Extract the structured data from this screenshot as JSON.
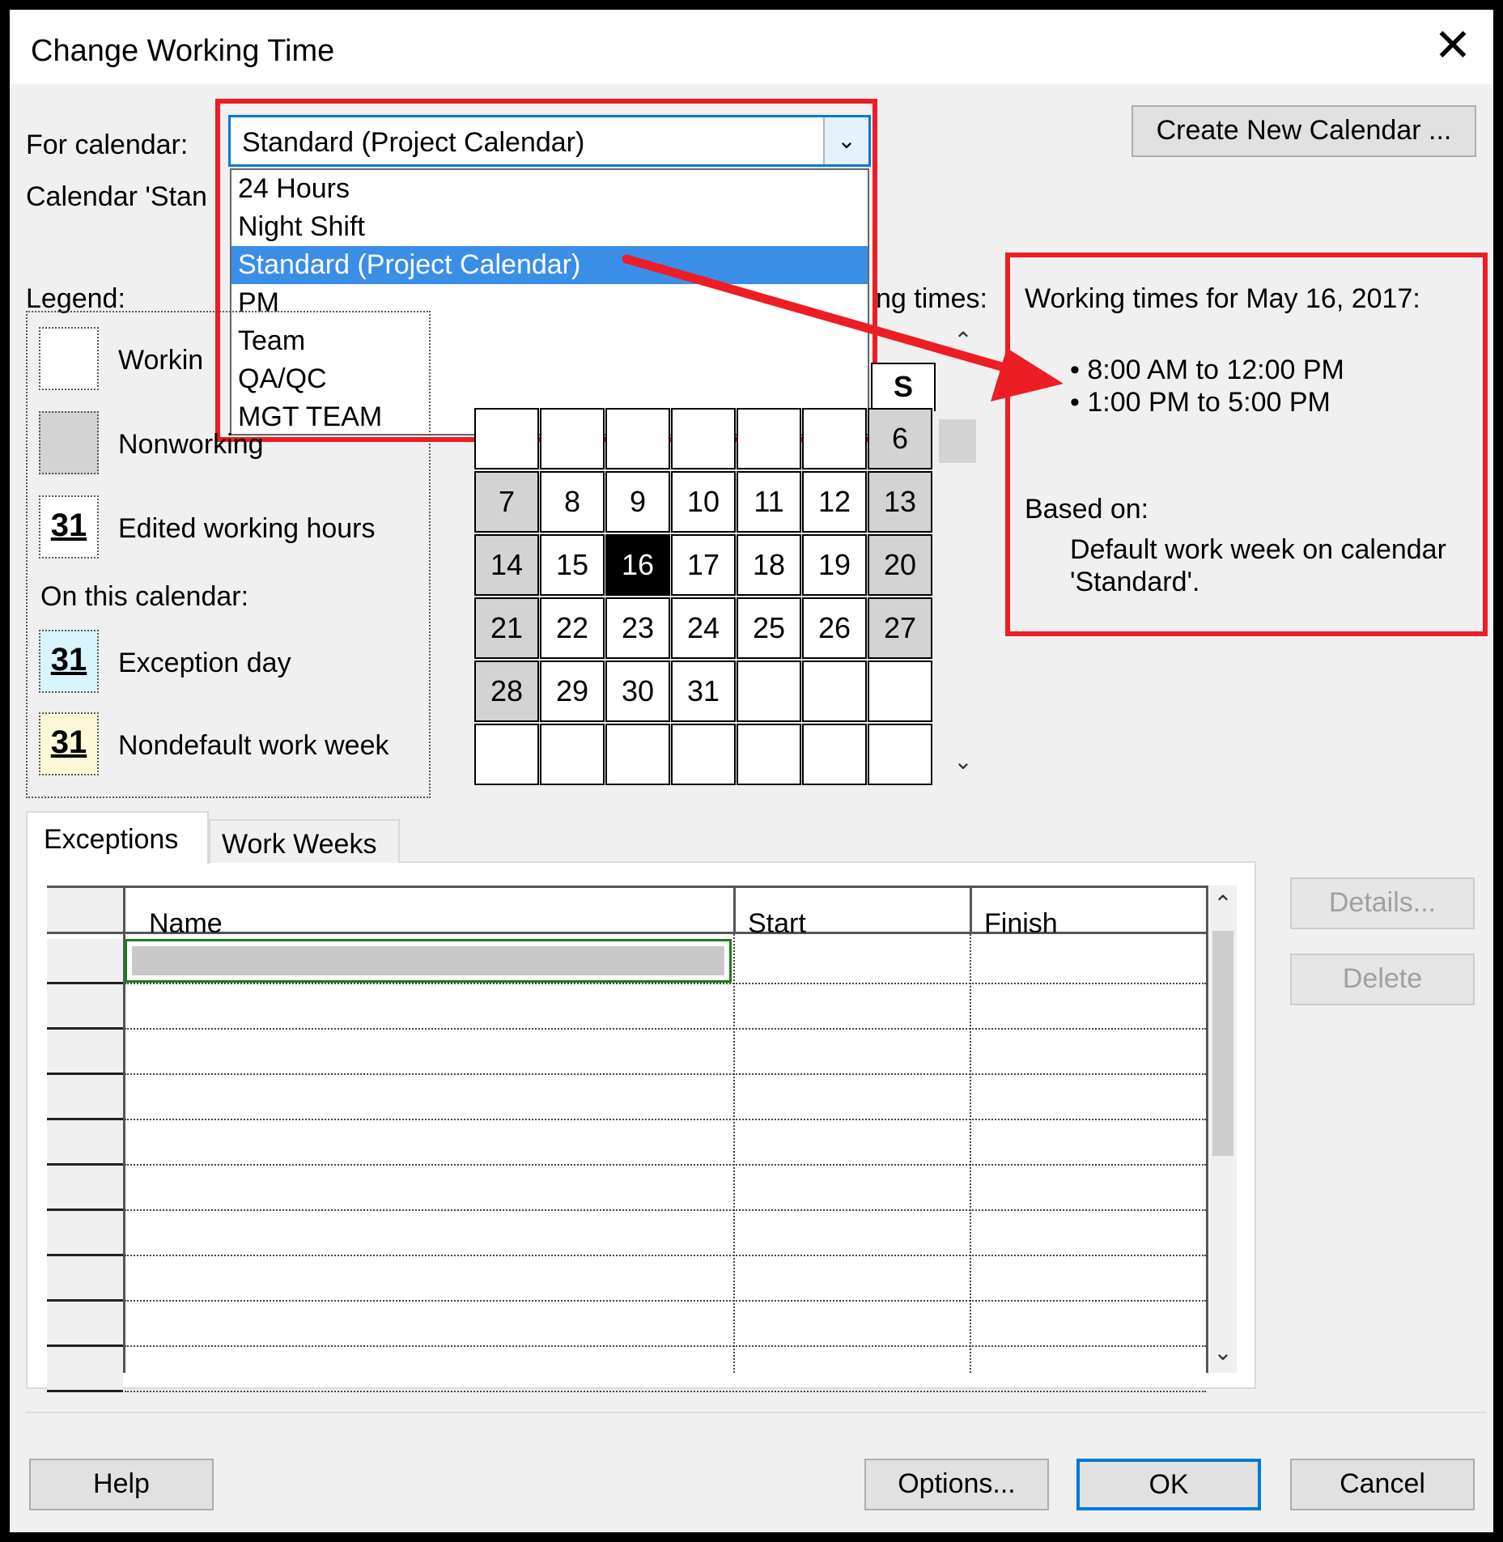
{
  "dialog": {
    "title": "Change Working Time"
  },
  "for_calendar": {
    "label": "For calendar:",
    "value": "Standard (Project Calendar)"
  },
  "calendar_caption": "Calendar 'Stan",
  "dropdown": {
    "items": [
      "24 Hours",
      "Night Shift",
      "Standard (Project Calendar)",
      "PM",
      "Team",
      "QA/QC",
      "MGT TEAM"
    ],
    "selected": "Standard (Project Calendar)"
  },
  "create_button": "Create New Calendar ...",
  "legend": {
    "title": "Legend:",
    "working": "Workin",
    "nonworking": "Nonworking",
    "edited": "Edited working hours",
    "on_this_calendar": "On this calendar:",
    "exception": "Exception day",
    "nondefault": "Nondefault work week",
    "swatch_num": "31"
  },
  "calendar_heading_fragment": "ng times:",
  "calendar": {
    "saturday_header": "S",
    "rows": [
      [
        "",
        "",
        "",
        "",
        "",
        "",
        "6"
      ],
      [
        "7",
        "8",
        "9",
        "10",
        "11",
        "12",
        "13"
      ],
      [
        "14",
        "15",
        "16",
        "17",
        "18",
        "19",
        "20"
      ],
      [
        "21",
        "22",
        "23",
        "24",
        "25",
        "26",
        "27"
      ],
      [
        "28",
        "29",
        "30",
        "31",
        "",
        "",
        ""
      ],
      [
        "",
        "",
        "",
        "",
        "",
        "",
        ""
      ]
    ],
    "selected_day": "16"
  },
  "working_times": {
    "heading": "Working times for May 16, 2017:",
    "times": [
      "• 8:00 AM to 12:00 PM",
      "• 1:00 PM to 5:00 PM"
    ],
    "based_on_label": "Based on:",
    "based_on_text_1": "Default work week on calendar",
    "based_on_text_2": "'Standard'."
  },
  "tabs": [
    "Exceptions",
    "Work Weeks"
  ],
  "table": {
    "columns": [
      "Name",
      "Start",
      "Finish"
    ]
  },
  "side_buttons": {
    "details": "Details...",
    "delete": "Delete"
  },
  "footer": {
    "help": "Help",
    "options": "Options...",
    "ok": "OK",
    "cancel": "Cancel"
  },
  "colors": {
    "accent": "#0078d7",
    "highlight_red": "#ee1c25",
    "selection_blue": "#3b8ee8",
    "nonworking_gray": "#d3d3d3"
  }
}
